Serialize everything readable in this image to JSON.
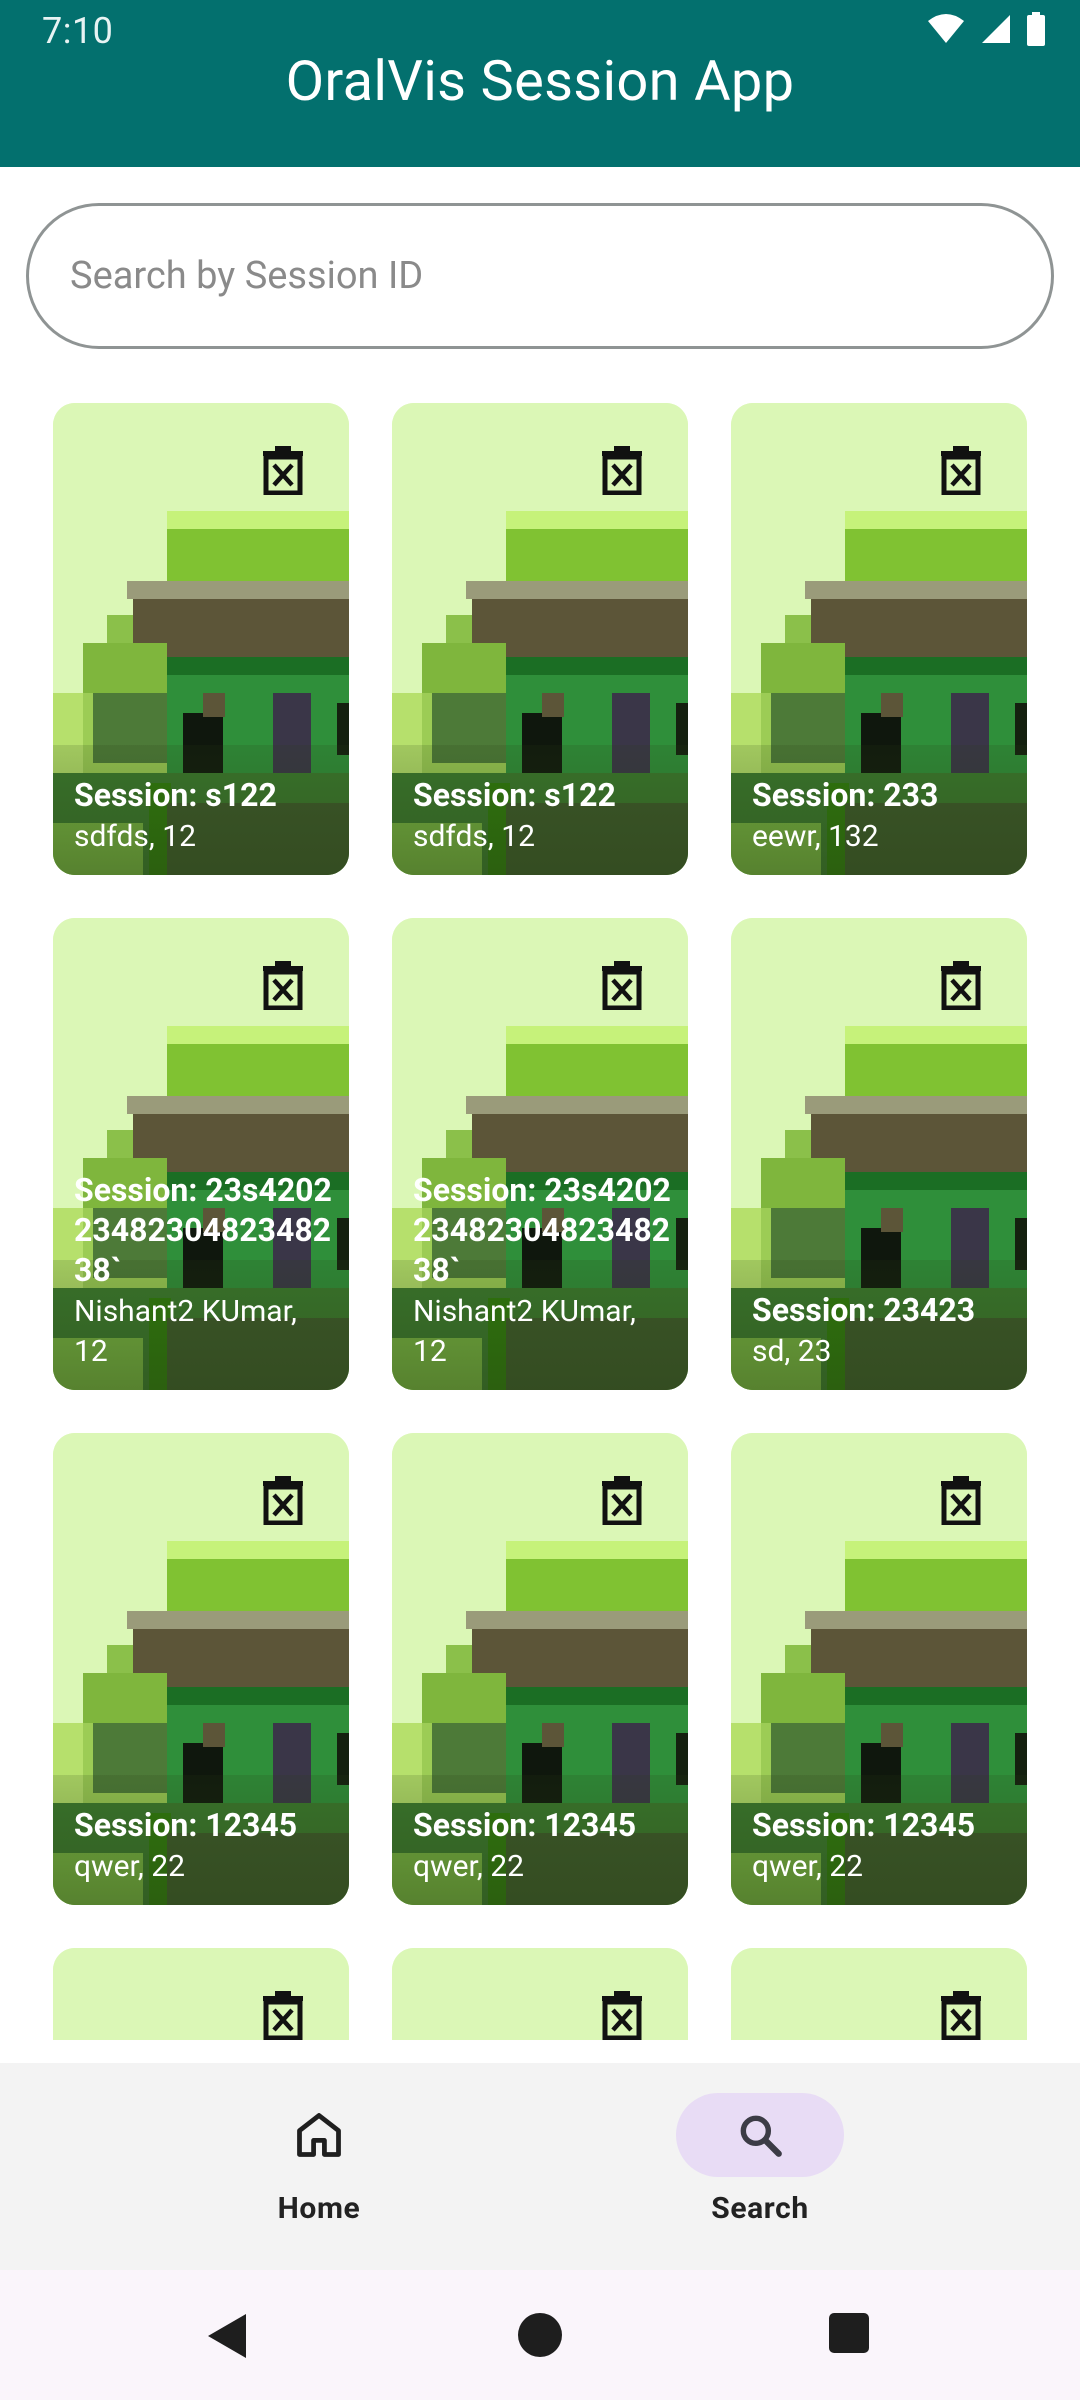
{
  "status": {
    "time": "7:10"
  },
  "app": {
    "title": "OralVis Session App"
  },
  "search": {
    "placeholder": "Search by Session ID",
    "value": ""
  },
  "sessions": [
    {
      "title": "Session: s122",
      "subtitle": "sdfds, 12"
    },
    {
      "title": "Session: s122",
      "subtitle": "sdfds, 12"
    },
    {
      "title": "Session: 233",
      "subtitle": "eewr, 132"
    },
    {
      "title": "Session: 23s42022348230482348238`",
      "subtitle": "Nishant2 KUmar, 12"
    },
    {
      "title": "Session: 23s42022348230482348238`",
      "subtitle": "Nishant2 KUmar, 12"
    },
    {
      "title": "Session: 23423",
      "subtitle": "sd, 23"
    },
    {
      "title": "Session: 12345",
      "subtitle": "qwer, 22"
    },
    {
      "title": "Session: 12345",
      "subtitle": "qwer, 22"
    },
    {
      "title": "Session: 12345",
      "subtitle": "qwer, 22"
    },
    {
      "title": "",
      "subtitle": ""
    },
    {
      "title": "",
      "subtitle": ""
    },
    {
      "title": "",
      "subtitle": ""
    }
  ],
  "bottom_nav": {
    "items": [
      {
        "label": "Home",
        "icon": "home-icon",
        "active": false
      },
      {
        "label": "Search",
        "icon": "search-icon",
        "active": true
      }
    ]
  },
  "colors": {
    "app_bar": "#03706E",
    "card_bg": "#DBF7B6",
    "nav_active_pill": "#E8DCF5"
  }
}
